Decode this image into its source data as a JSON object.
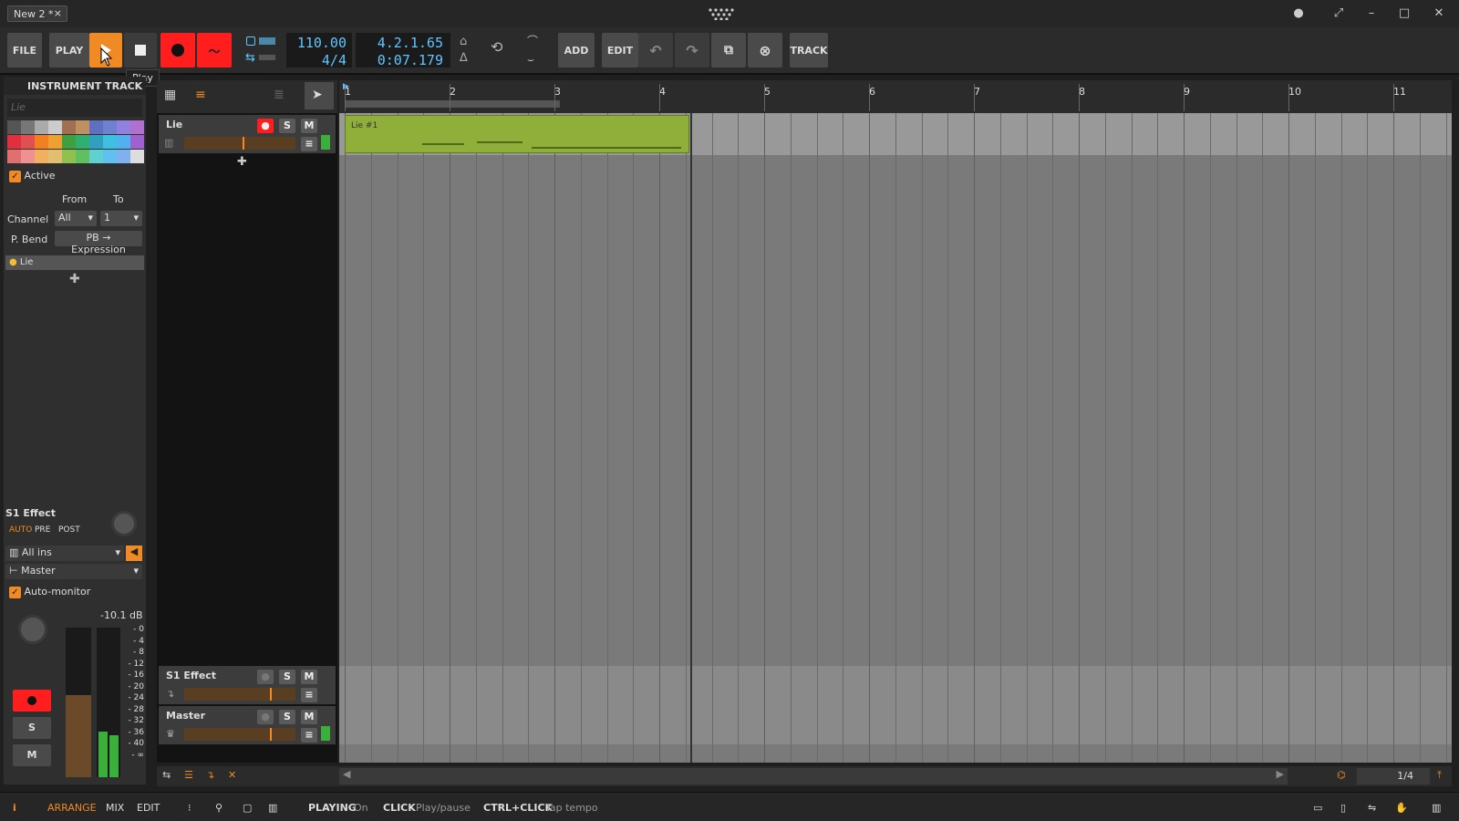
{
  "window": {
    "tab_title": "New 2 *",
    "tab_close": "×",
    "center_icon": "grid-logo",
    "controls": [
      "●",
      "⤢",
      "–",
      "□",
      "✕"
    ]
  },
  "toolbar": {
    "file": "FILE",
    "play_menu": "PLAY",
    "add": "ADD",
    "edit": "EDIT",
    "track": "TRACK",
    "tempo": "110.00",
    "time_sig": "4/4",
    "position": "4.2.1.65",
    "time": "0:07.179",
    "tooltip": "Play",
    "colors": {
      "play_active": "#f08a24",
      "record": "#ff1e1e",
      "accent": "#f08a24"
    }
  },
  "inspector": {
    "header": "INSTRUMENT TRACK",
    "name_field": "Lie",
    "active_label": "Active",
    "from_label": "From",
    "to_label": "To",
    "channel_label": "Channel",
    "channel_from": "All",
    "channel_to": "1",
    "pbend_label": "P. Bend",
    "pbend_value": "PB → Expression",
    "device_item": "Lie",
    "send_title": "S1 Effect",
    "auto": "AUTO",
    "pre": "PRE",
    "post": "POST",
    "input": "All ins",
    "output": "Master",
    "automonitor": "Auto-monitor",
    "db": "-10.1 dB",
    "meter_scale": [
      "0",
      "4",
      "8",
      "12",
      "16",
      "20",
      "24",
      "28",
      "32",
      "36",
      "40",
      "∞"
    ],
    "s": "S",
    "m": "M"
  },
  "tracks": [
    {
      "name": "Lie",
      "s": "S",
      "m": "M"
    },
    {
      "name": "S1 Effect",
      "s": "S",
      "m": "M"
    },
    {
      "name": "Master",
      "s": "S",
      "m": "M"
    }
  ],
  "ruler": [
    "1",
    "2",
    "3",
    "4",
    "5",
    "6",
    "7",
    "8",
    "9",
    "10",
    "11"
  ],
  "clip": {
    "name": "Lie #1",
    "color": "#8fae3a"
  },
  "zoom": "1/4",
  "status": {
    "arrange": "ARRANGE",
    "mix": "MIX",
    "edit": "EDIT",
    "playing_label": "PLAYING",
    "playing_value": "On",
    "click_label": "CLICK",
    "click_value": "Play/pause",
    "ctrl_label": "CTRL+CLICK",
    "ctrl_value": "Tap tempo"
  }
}
